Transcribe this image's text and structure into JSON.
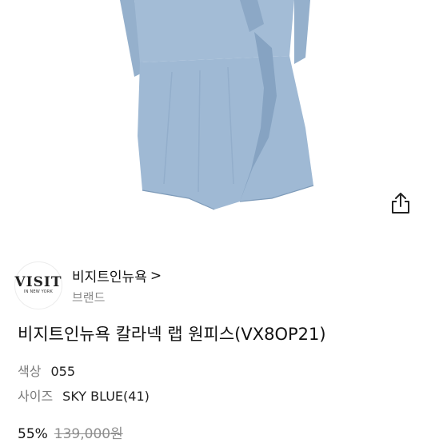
{
  "product_image": {
    "subject": "sky blue wrap dress",
    "colors": {
      "dress": "#9FB9D4",
      "dress_shadow": "#86A3C2",
      "background": "#FFFFFF"
    }
  },
  "share": {
    "icon": "share-icon"
  },
  "brand": {
    "logo_text": "VISIT",
    "logo_subtext": "IN NEW YORK",
    "name": "비지트인뉴욕",
    "chevron": ">",
    "type_label": "브랜드"
  },
  "product": {
    "title": "비지트인뉴욕 칼라넥 랩 원피스(VX8OP21)",
    "color_label": "색상",
    "color_value": "055",
    "size_label": "사이즈",
    "size_value": "SKY BLUE(41)"
  },
  "price": {
    "discount": "55%",
    "original": "139,000원"
  }
}
